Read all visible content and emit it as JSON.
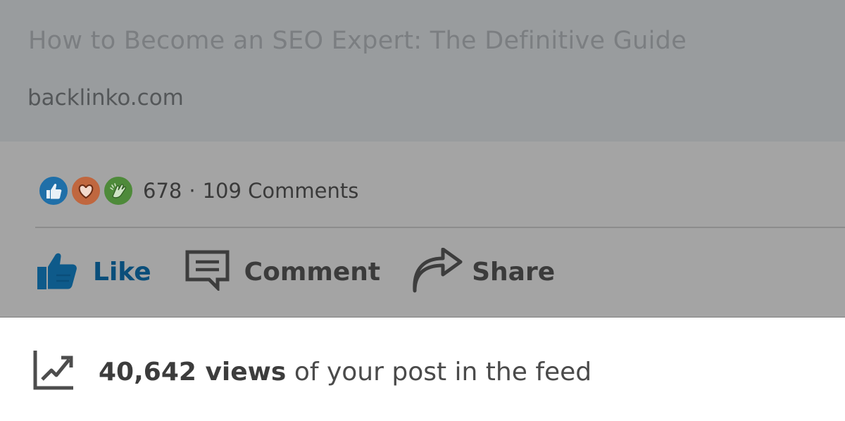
{
  "link_preview": {
    "title": "How to Become an SEO Expert: The Definitive Guide",
    "domain": "backlinko.com"
  },
  "social_counts": {
    "reactions": [
      {
        "icon": "like-reaction-icon",
        "color": "#1f6fa8"
      },
      {
        "icon": "love-reaction-icon",
        "color": "#c0673f"
      },
      {
        "icon": "celebrate-reaction-icon",
        "color": "#4e8a3a"
      }
    ],
    "reaction_count": "678",
    "separator": "·",
    "comments_label": "109 Comments"
  },
  "actions": {
    "like_label": "Like",
    "comment_label": "Comment",
    "share_label": "Share"
  },
  "analytics": {
    "icon": "trending-chart-icon",
    "views_bold": "40,642 views",
    "views_suffix": " of your post in the feed"
  },
  "colors": {
    "overlay_card": "#999c9e",
    "overlay_panel": "#a4a4a4",
    "like_blue": "#0a4e7a",
    "background": "#ffffff"
  }
}
